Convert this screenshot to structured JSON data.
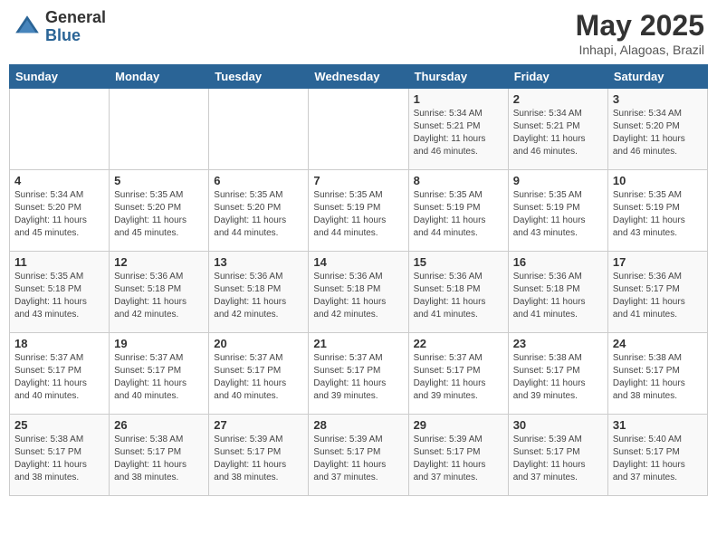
{
  "header": {
    "logo_general": "General",
    "logo_blue": "Blue",
    "title": "May 2025",
    "location": "Inhapi, Alagoas, Brazil"
  },
  "weekdays": [
    "Sunday",
    "Monday",
    "Tuesday",
    "Wednesday",
    "Thursday",
    "Friday",
    "Saturday"
  ],
  "weeks": [
    [
      {
        "day": "",
        "info": ""
      },
      {
        "day": "",
        "info": ""
      },
      {
        "day": "",
        "info": ""
      },
      {
        "day": "",
        "info": ""
      },
      {
        "day": "1",
        "info": "Sunrise: 5:34 AM\nSunset: 5:21 PM\nDaylight: 11 hours\nand 46 minutes."
      },
      {
        "day": "2",
        "info": "Sunrise: 5:34 AM\nSunset: 5:21 PM\nDaylight: 11 hours\nand 46 minutes."
      },
      {
        "day": "3",
        "info": "Sunrise: 5:34 AM\nSunset: 5:20 PM\nDaylight: 11 hours\nand 46 minutes."
      }
    ],
    [
      {
        "day": "4",
        "info": "Sunrise: 5:34 AM\nSunset: 5:20 PM\nDaylight: 11 hours\nand 45 minutes."
      },
      {
        "day": "5",
        "info": "Sunrise: 5:35 AM\nSunset: 5:20 PM\nDaylight: 11 hours\nand 45 minutes."
      },
      {
        "day": "6",
        "info": "Sunrise: 5:35 AM\nSunset: 5:20 PM\nDaylight: 11 hours\nand 44 minutes."
      },
      {
        "day": "7",
        "info": "Sunrise: 5:35 AM\nSunset: 5:19 PM\nDaylight: 11 hours\nand 44 minutes."
      },
      {
        "day": "8",
        "info": "Sunrise: 5:35 AM\nSunset: 5:19 PM\nDaylight: 11 hours\nand 44 minutes."
      },
      {
        "day": "9",
        "info": "Sunrise: 5:35 AM\nSunset: 5:19 PM\nDaylight: 11 hours\nand 43 minutes."
      },
      {
        "day": "10",
        "info": "Sunrise: 5:35 AM\nSunset: 5:19 PM\nDaylight: 11 hours\nand 43 minutes."
      }
    ],
    [
      {
        "day": "11",
        "info": "Sunrise: 5:35 AM\nSunset: 5:18 PM\nDaylight: 11 hours\nand 43 minutes."
      },
      {
        "day": "12",
        "info": "Sunrise: 5:36 AM\nSunset: 5:18 PM\nDaylight: 11 hours\nand 42 minutes."
      },
      {
        "day": "13",
        "info": "Sunrise: 5:36 AM\nSunset: 5:18 PM\nDaylight: 11 hours\nand 42 minutes."
      },
      {
        "day": "14",
        "info": "Sunrise: 5:36 AM\nSunset: 5:18 PM\nDaylight: 11 hours\nand 42 minutes."
      },
      {
        "day": "15",
        "info": "Sunrise: 5:36 AM\nSunset: 5:18 PM\nDaylight: 11 hours\nand 41 minutes."
      },
      {
        "day": "16",
        "info": "Sunrise: 5:36 AM\nSunset: 5:18 PM\nDaylight: 11 hours\nand 41 minutes."
      },
      {
        "day": "17",
        "info": "Sunrise: 5:36 AM\nSunset: 5:17 PM\nDaylight: 11 hours\nand 41 minutes."
      }
    ],
    [
      {
        "day": "18",
        "info": "Sunrise: 5:37 AM\nSunset: 5:17 PM\nDaylight: 11 hours\nand 40 minutes."
      },
      {
        "day": "19",
        "info": "Sunrise: 5:37 AM\nSunset: 5:17 PM\nDaylight: 11 hours\nand 40 minutes."
      },
      {
        "day": "20",
        "info": "Sunrise: 5:37 AM\nSunset: 5:17 PM\nDaylight: 11 hours\nand 40 minutes."
      },
      {
        "day": "21",
        "info": "Sunrise: 5:37 AM\nSunset: 5:17 PM\nDaylight: 11 hours\nand 39 minutes."
      },
      {
        "day": "22",
        "info": "Sunrise: 5:37 AM\nSunset: 5:17 PM\nDaylight: 11 hours\nand 39 minutes."
      },
      {
        "day": "23",
        "info": "Sunrise: 5:38 AM\nSunset: 5:17 PM\nDaylight: 11 hours\nand 39 minutes."
      },
      {
        "day": "24",
        "info": "Sunrise: 5:38 AM\nSunset: 5:17 PM\nDaylight: 11 hours\nand 38 minutes."
      }
    ],
    [
      {
        "day": "25",
        "info": "Sunrise: 5:38 AM\nSunset: 5:17 PM\nDaylight: 11 hours\nand 38 minutes."
      },
      {
        "day": "26",
        "info": "Sunrise: 5:38 AM\nSunset: 5:17 PM\nDaylight: 11 hours\nand 38 minutes."
      },
      {
        "day": "27",
        "info": "Sunrise: 5:39 AM\nSunset: 5:17 PM\nDaylight: 11 hours\nand 38 minutes."
      },
      {
        "day": "28",
        "info": "Sunrise: 5:39 AM\nSunset: 5:17 PM\nDaylight: 11 hours\nand 37 minutes."
      },
      {
        "day": "29",
        "info": "Sunrise: 5:39 AM\nSunset: 5:17 PM\nDaylight: 11 hours\nand 37 minutes."
      },
      {
        "day": "30",
        "info": "Sunrise: 5:39 AM\nSunset: 5:17 PM\nDaylight: 11 hours\nand 37 minutes."
      },
      {
        "day": "31",
        "info": "Sunrise: 5:40 AM\nSunset: 5:17 PM\nDaylight: 11 hours\nand 37 minutes."
      }
    ]
  ]
}
